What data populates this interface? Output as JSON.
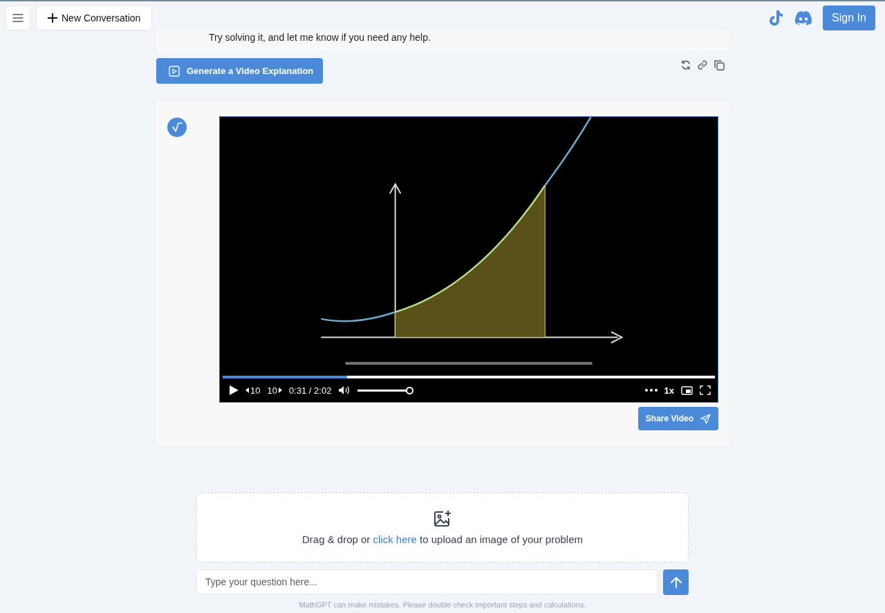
{
  "header": {
    "new_conversation": "New Conversation",
    "sign_in": "Sign In"
  },
  "previous_message": {
    "text": "Try solving it, and let me know if you need any help."
  },
  "generate_button": "Generate a Video Explanation",
  "video": {
    "kind": "picture",
    "progress": {
      "level": 0.253
    },
    "skip_back": "10",
    "skip_forward": "10",
    "time": "0:31 / 2:02",
    "volume": {
      "level": 1
    },
    "speed": "1x"
  },
  "share_button": "Share Video",
  "upload": {
    "before": "Drag & drop or",
    "link": "click here",
    "after": "to upload an image of your problem"
  },
  "question": {
    "placeholder": "Type your question here..."
  },
  "disclaimer": "MathGPT can make mistakes. Please double check important steps and calculations."
}
